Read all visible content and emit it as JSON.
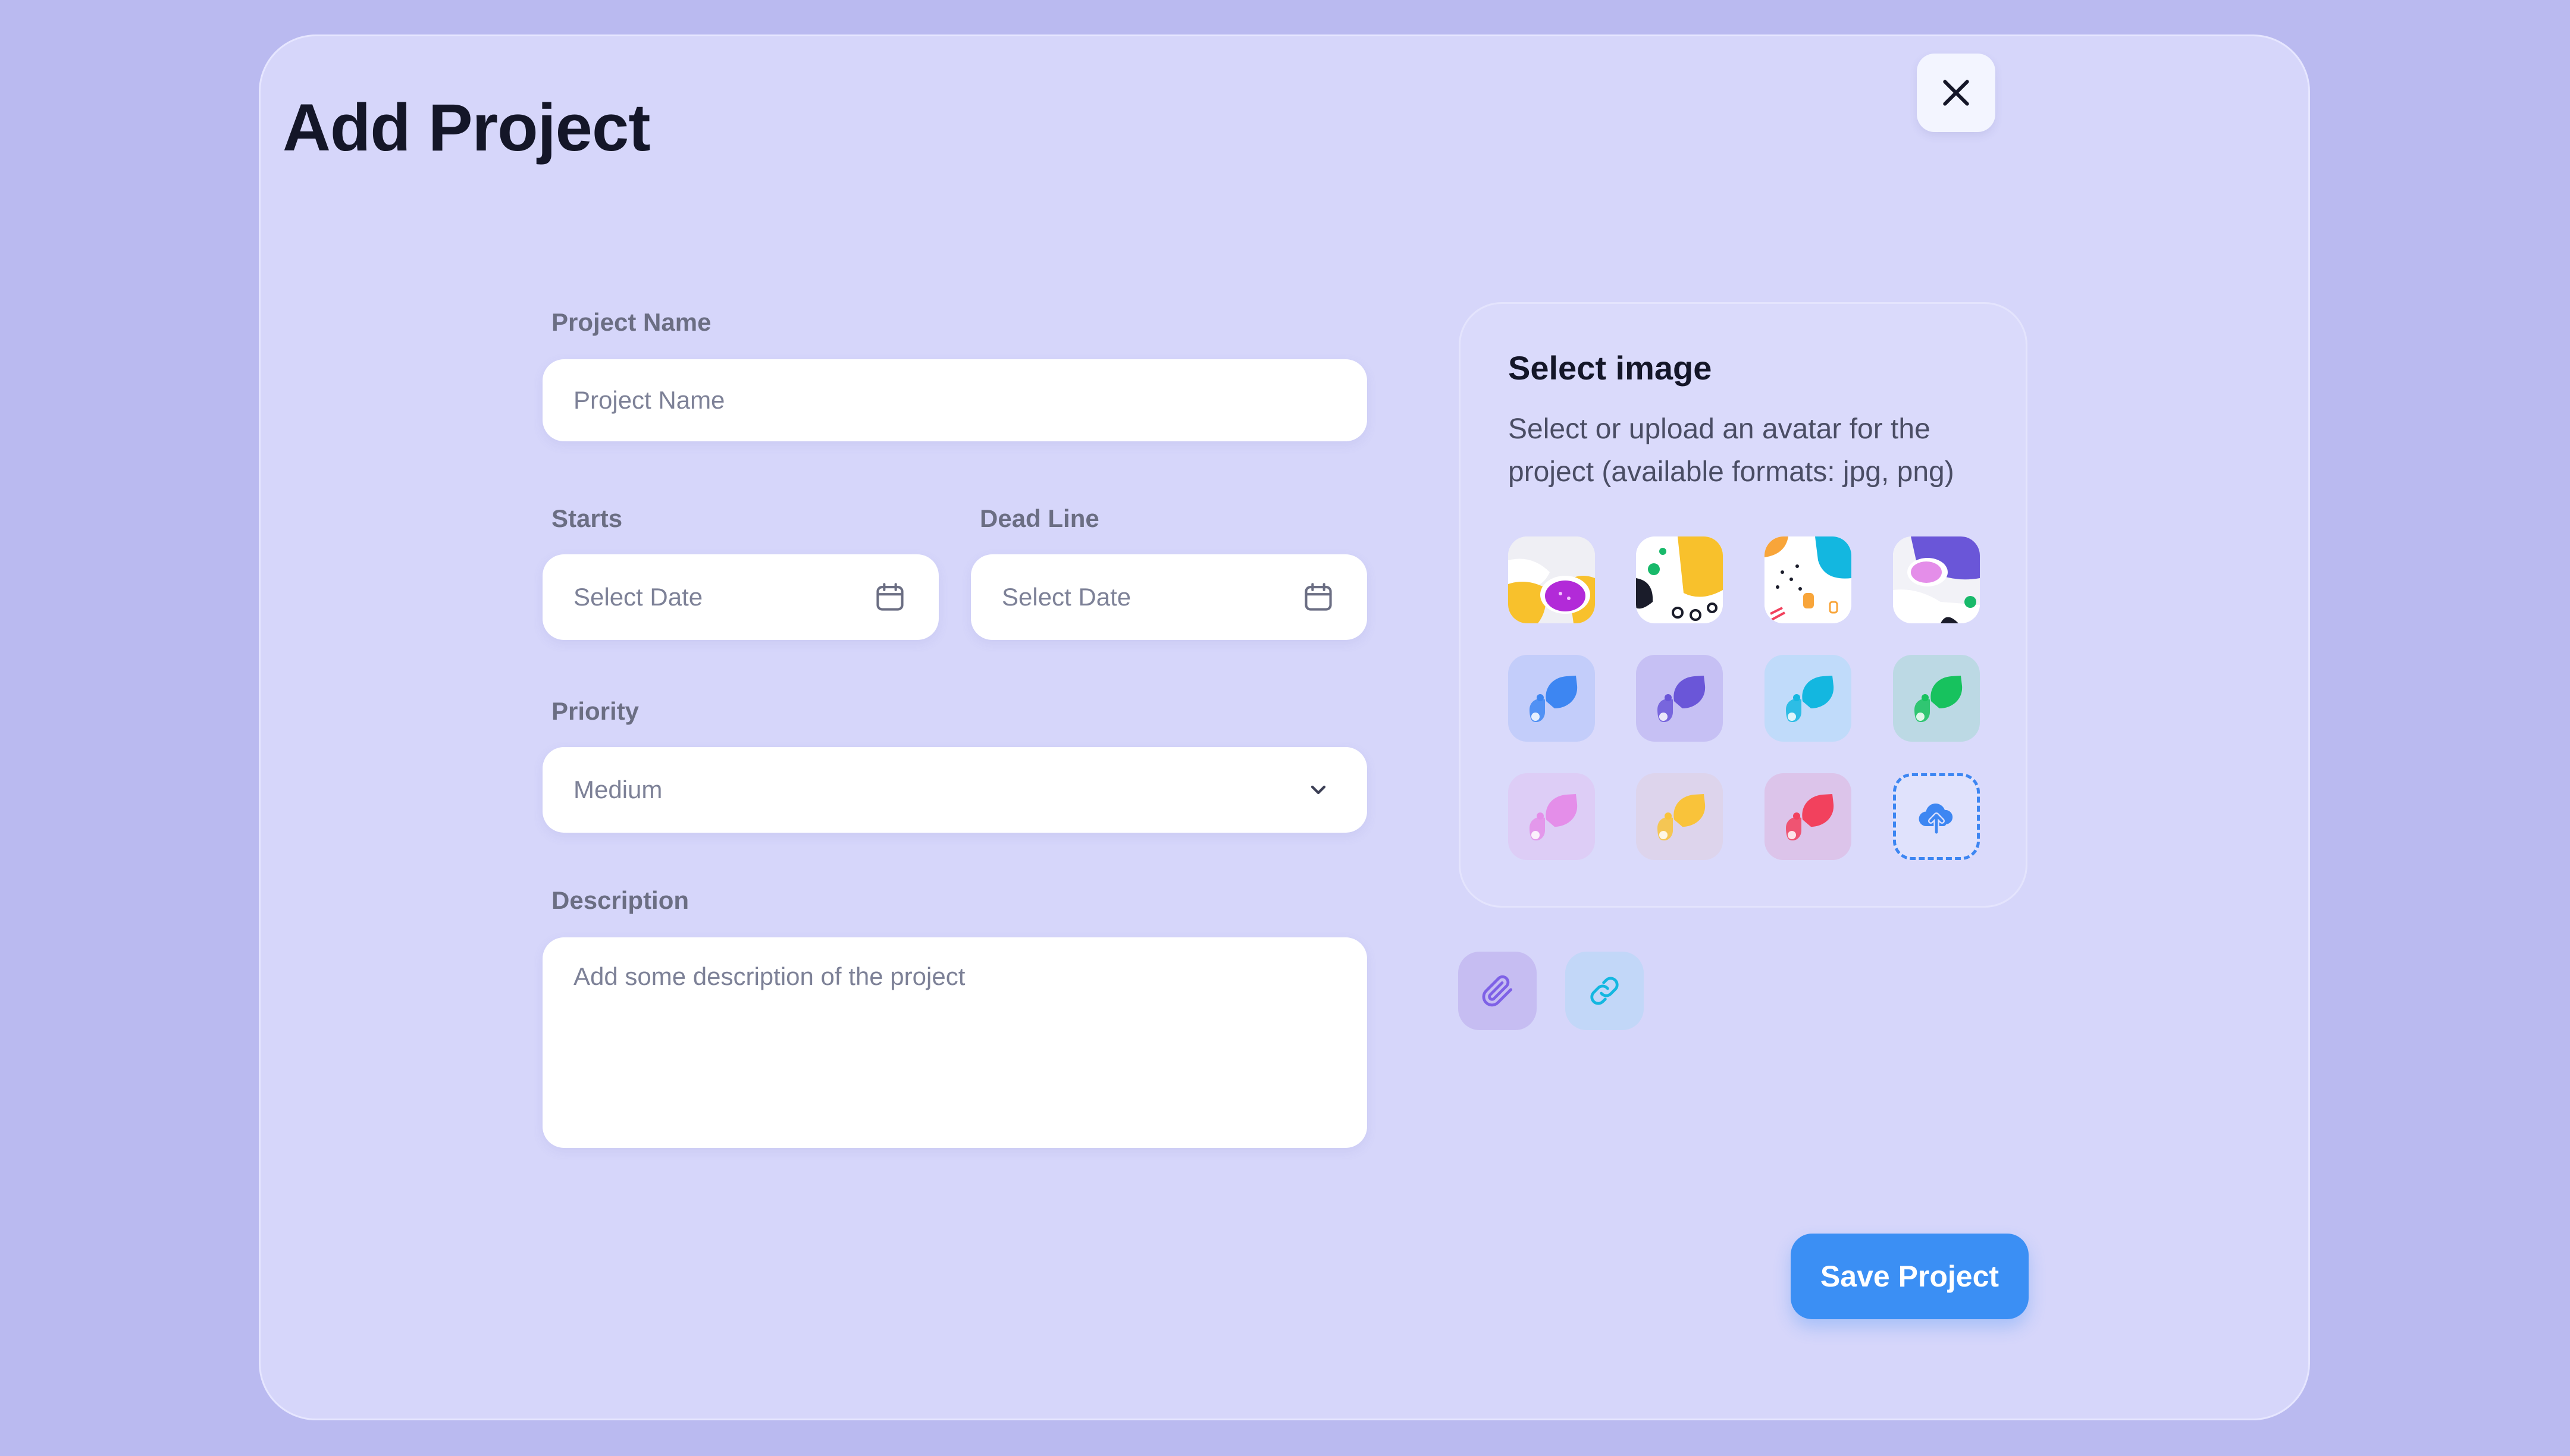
{
  "dialog": {
    "title": "Add Project",
    "close_icon": "close-icon"
  },
  "form": {
    "project_name": {
      "label": "Project Name",
      "placeholder": "Project Name",
      "value": ""
    },
    "starts": {
      "label": "Starts",
      "placeholder": "Select Date",
      "icon": "calendar-icon"
    },
    "deadline": {
      "label": "Dead Line",
      "placeholder": "Select Date",
      "icon": "calendar-icon"
    },
    "priority": {
      "label": "Priority",
      "selected": "Medium",
      "icon": "chevron-down-icon"
    },
    "description": {
      "label": "Description",
      "placeholder": "Add some description of the project",
      "value": ""
    }
  },
  "image_picker": {
    "title": "Select image",
    "description": "Select or upload an avatar for the project (available formats: jpg, png)",
    "avatars": [
      {
        "kind": "pattern",
        "name": "pattern-1"
      },
      {
        "kind": "pattern",
        "name": "pattern-2"
      },
      {
        "kind": "pattern",
        "name": "pattern-3"
      },
      {
        "kind": "pattern",
        "name": "pattern-4"
      },
      {
        "kind": "logo",
        "color": "#3d86f2",
        "bg": "#c3cdfa"
      },
      {
        "kind": "logo",
        "color": "#6a56d8",
        "bg": "#c6c0f4"
      },
      {
        "kind": "logo",
        "color": "#13b7e0",
        "bg": "#c0dbfa"
      },
      {
        "kind": "logo",
        "color": "#17c25e",
        "bg": "#bcd9e4"
      },
      {
        "kind": "logo",
        "color": "#e48ee9",
        "bg": "#ddcdf6"
      },
      {
        "kind": "logo",
        "color": "#f9c33a",
        "bg": "#ddd4ec"
      },
      {
        "kind": "logo",
        "color": "#f2415d",
        "bg": "#dcc4ea"
      }
    ],
    "upload_icon": "cloud-upload-icon"
  },
  "attachments": {
    "attach_icon": "paperclip-icon",
    "link_icon": "link-icon",
    "attach_color": "#7e61e6",
    "link_color": "#13b7e0"
  },
  "actions": {
    "save_label": "Save Project"
  },
  "colors": {
    "background": "#babaf0",
    "modal": "#d6d6fa",
    "accent": "#3b8ff4",
    "title": "#141628"
  }
}
